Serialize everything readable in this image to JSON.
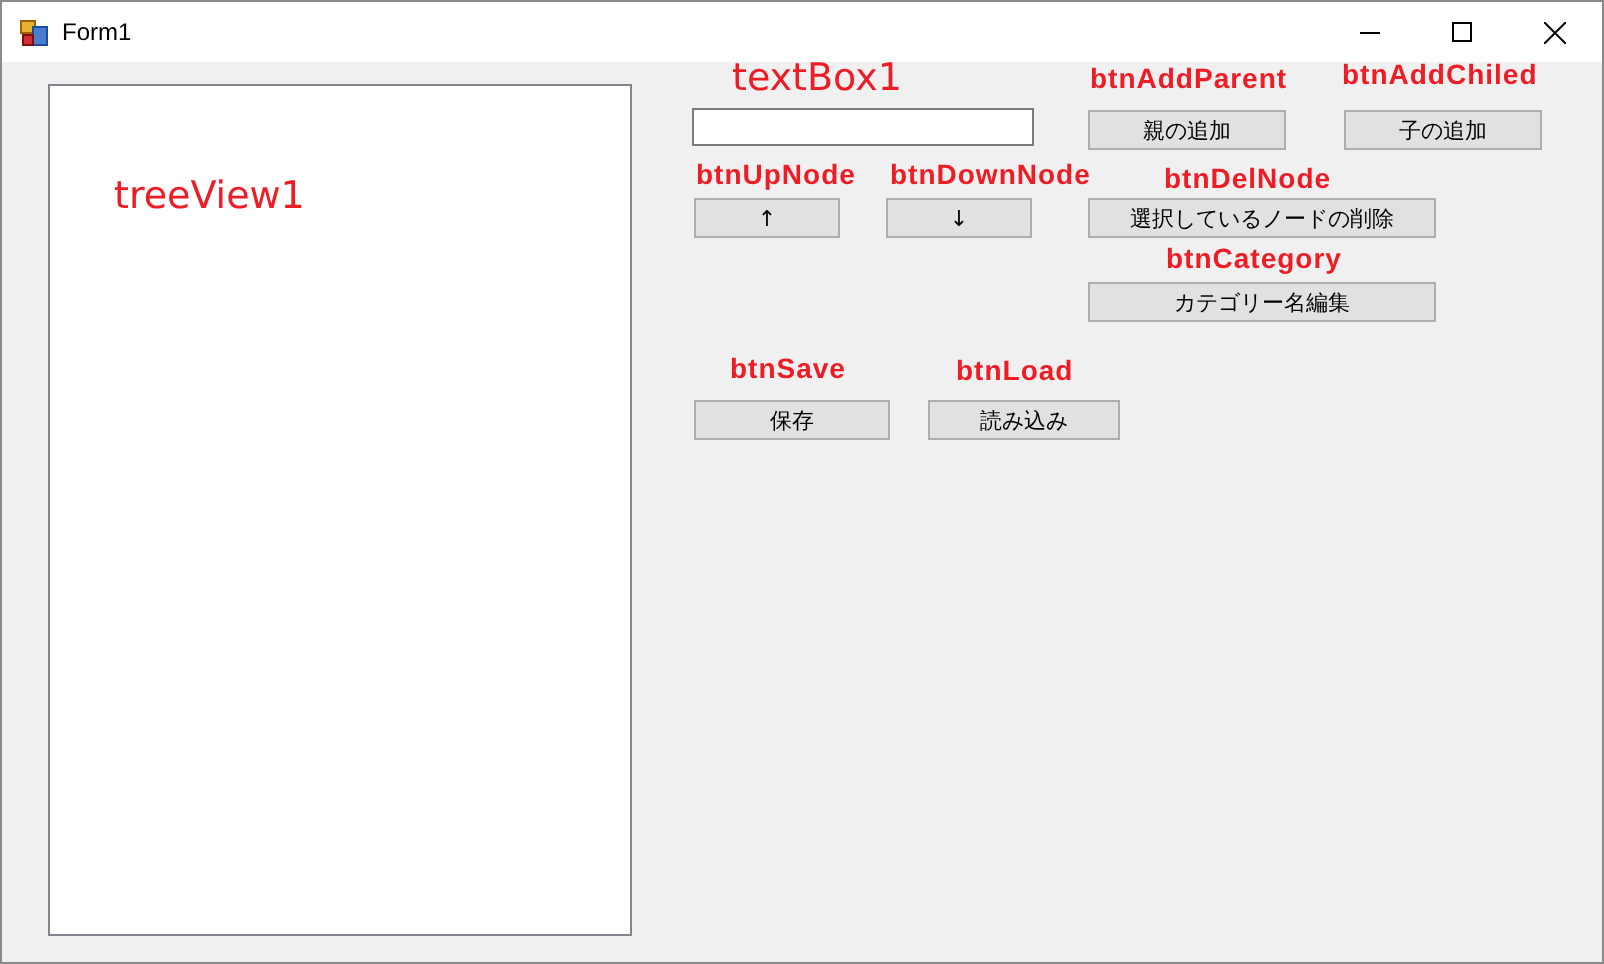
{
  "window": {
    "title": "Form1"
  },
  "tree_view": {
    "annotation": "treeView1"
  },
  "controls": [
    {
      "kind": "textbox",
      "annotation": "textBox1"
    },
    {
      "kind": "button",
      "annotation": "btnAddParent",
      "text": "親の追加"
    },
    {
      "kind": "button",
      "annotation": "btnAddChiled",
      "text": "子の追加"
    },
    {
      "kind": "button",
      "annotation": "btnUpNode",
      "text": "↑"
    },
    {
      "kind": "button",
      "annotation": "btnDownNode",
      "text": "↓"
    },
    {
      "kind": "button",
      "annotation": "btnDelNode",
      "text": "選択しているノードの削除"
    },
    {
      "kind": "button",
      "annotation": "btnCategory",
      "text": "カテゴリー名編集"
    },
    {
      "kind": "button",
      "annotation": "btnSave",
      "text": "保存"
    },
    {
      "kind": "button",
      "annotation": "btnLoad",
      "text": "読み込み"
    }
  ]
}
